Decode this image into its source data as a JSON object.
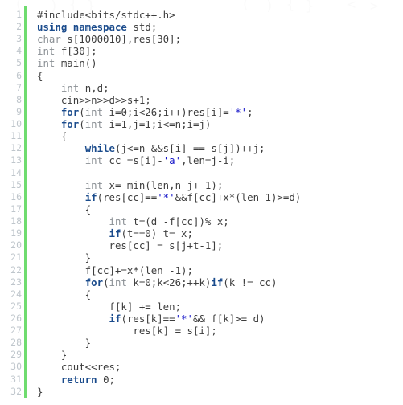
{
  "document": {
    "kind": "source-code-listing",
    "language": "C++",
    "total_lines": 32,
    "gutter_accent_color": "#6fdc6f",
    "line_number_color": "#bfc6cc",
    "keyword_color": "#1a4b8c",
    "type_color": "#8a8f94",
    "string_color": "#1414c8",
    "text_color": "#3d3d3d",
    "background_color": "#ffffff"
  },
  "watermark": {
    "glyphs": [
      "(",
      ")",
      "{",
      "}",
      "(",
      ")",
      "{",
      "}",
      "<",
      ">"
    ]
  },
  "lines": [
    {
      "n": "1",
      "tokens": [
        {
          "t": "pre",
          "s": "#include<bits/stdc++.h>"
        }
      ]
    },
    {
      "n": "2",
      "tokens": [
        {
          "t": "kw",
          "s": "using namespace"
        },
        {
          "t": "pln",
          "s": " std;"
        }
      ]
    },
    {
      "n": "3",
      "tokens": [
        {
          "t": "type",
          "s": "char"
        },
        {
          "t": "pln",
          "s": " s[1000010],res[30];"
        }
      ]
    },
    {
      "n": "4",
      "tokens": [
        {
          "t": "type",
          "s": "int"
        },
        {
          "t": "pln",
          "s": " f[30];"
        }
      ]
    },
    {
      "n": "5",
      "tokens": [
        {
          "t": "type",
          "s": "int"
        },
        {
          "t": "pln",
          "s": " main()"
        }
      ]
    },
    {
      "n": "6",
      "tokens": [
        {
          "t": "pln",
          "s": "{"
        }
      ]
    },
    {
      "n": "7",
      "tokens": [
        {
          "t": "pln",
          "s": "    "
        },
        {
          "t": "type",
          "s": "int"
        },
        {
          "t": "pln",
          "s": " n,d;"
        }
      ]
    },
    {
      "n": "8",
      "tokens": [
        {
          "t": "pln",
          "s": "    cin>>n>>d>>s+1;"
        }
      ]
    },
    {
      "n": "9",
      "tokens": [
        {
          "t": "pln",
          "s": "    "
        },
        {
          "t": "kw",
          "s": "for"
        },
        {
          "t": "pln",
          "s": "("
        },
        {
          "t": "type",
          "s": "int"
        },
        {
          "t": "pln",
          "s": " i=0;i<26;i++)res[i]="
        },
        {
          "t": "str",
          "s": "'*'"
        },
        {
          "t": "pln",
          "s": ";"
        }
      ]
    },
    {
      "n": "10",
      "tokens": [
        {
          "t": "pln",
          "s": "    "
        },
        {
          "t": "kw",
          "s": "for"
        },
        {
          "t": "pln",
          "s": "("
        },
        {
          "t": "type",
          "s": "int"
        },
        {
          "t": "pln",
          "s": " i=1,j=1;i<=n;i=j)"
        }
      ]
    },
    {
      "n": "11",
      "tokens": [
        {
          "t": "pln",
          "s": "    {"
        }
      ]
    },
    {
      "n": "12",
      "tokens": [
        {
          "t": "pln",
          "s": "        "
        },
        {
          "t": "kw",
          "s": "while"
        },
        {
          "t": "pln",
          "s": "(j<=n &&s[i] == s[j])++j;"
        }
      ]
    },
    {
      "n": "13",
      "tokens": [
        {
          "t": "pln",
          "s": "        "
        },
        {
          "t": "type",
          "s": "int"
        },
        {
          "t": "pln",
          "s": " cc =s[i]-"
        },
        {
          "t": "str",
          "s": "'a'"
        },
        {
          "t": "pln",
          "s": ",len=j-i;"
        }
      ]
    },
    {
      "n": "14",
      "tokens": [
        {
          "t": "pln",
          "s": ""
        }
      ]
    },
    {
      "n": "15",
      "tokens": [
        {
          "t": "pln",
          "s": "        "
        },
        {
          "t": "type",
          "s": "int"
        },
        {
          "t": "pln",
          "s": " x= min(len,n-j+ 1);"
        }
      ]
    },
    {
      "n": "16",
      "tokens": [
        {
          "t": "pln",
          "s": "        "
        },
        {
          "t": "kw",
          "s": "if"
        },
        {
          "t": "pln",
          "s": "(res[cc]=="
        },
        {
          "t": "str",
          "s": "'*'"
        },
        {
          "t": "pln",
          "s": "&&f[cc]+x*(len-1)>=d)"
        }
      ]
    },
    {
      "n": "17",
      "tokens": [
        {
          "t": "pln",
          "s": "        {"
        }
      ]
    },
    {
      "n": "18",
      "tokens": [
        {
          "t": "pln",
          "s": "            "
        },
        {
          "t": "type",
          "s": "int"
        },
        {
          "t": "pln",
          "s": " t=(d -f[cc])% x;"
        }
      ]
    },
    {
      "n": "19",
      "tokens": [
        {
          "t": "pln",
          "s": "            "
        },
        {
          "t": "kw",
          "s": "if"
        },
        {
          "t": "pln",
          "s": "(t==0) t= x;"
        }
      ]
    },
    {
      "n": "20",
      "tokens": [
        {
          "t": "pln",
          "s": "            res[cc] = s[j+t-1];"
        }
      ]
    },
    {
      "n": "21",
      "tokens": [
        {
          "t": "pln",
          "s": "        }"
        }
      ]
    },
    {
      "n": "22",
      "tokens": [
        {
          "t": "pln",
          "s": "        f[cc]+=x*(len -1);"
        }
      ]
    },
    {
      "n": "23",
      "tokens": [
        {
          "t": "pln",
          "s": "        "
        },
        {
          "t": "kw",
          "s": "for"
        },
        {
          "t": "pln",
          "s": "("
        },
        {
          "t": "type",
          "s": "int"
        },
        {
          "t": "pln",
          "s": " k=0;k<26;++k)"
        },
        {
          "t": "kw",
          "s": "if"
        },
        {
          "t": "pln",
          "s": "(k != cc)"
        }
      ]
    },
    {
      "n": "24",
      "tokens": [
        {
          "t": "pln",
          "s": "        {"
        }
      ]
    },
    {
      "n": "25",
      "tokens": [
        {
          "t": "pln",
          "s": "            f[k] += len;"
        }
      ]
    },
    {
      "n": "26",
      "tokens": [
        {
          "t": "pln",
          "s": "            "
        },
        {
          "t": "kw",
          "s": "if"
        },
        {
          "t": "pln",
          "s": "(res[k]=="
        },
        {
          "t": "str",
          "s": "'*'"
        },
        {
          "t": "pln",
          "s": "&& f[k]>= d)"
        }
      ]
    },
    {
      "n": "27",
      "tokens": [
        {
          "t": "pln",
          "s": "                res[k] = s[i];"
        }
      ]
    },
    {
      "n": "28",
      "tokens": [
        {
          "t": "pln",
          "s": "        }"
        }
      ]
    },
    {
      "n": "29",
      "tokens": [
        {
          "t": "pln",
          "s": "    }"
        }
      ]
    },
    {
      "n": "30",
      "tokens": [
        {
          "t": "pln",
          "s": "    cout<<res;"
        }
      ]
    },
    {
      "n": "31",
      "tokens": [
        {
          "t": "pln",
          "s": "    "
        },
        {
          "t": "kw",
          "s": "return"
        },
        {
          "t": "pln",
          "s": " 0;"
        }
      ]
    },
    {
      "n": "32",
      "tokens": [
        {
          "t": "pln",
          "s": "}"
        }
      ]
    }
  ]
}
